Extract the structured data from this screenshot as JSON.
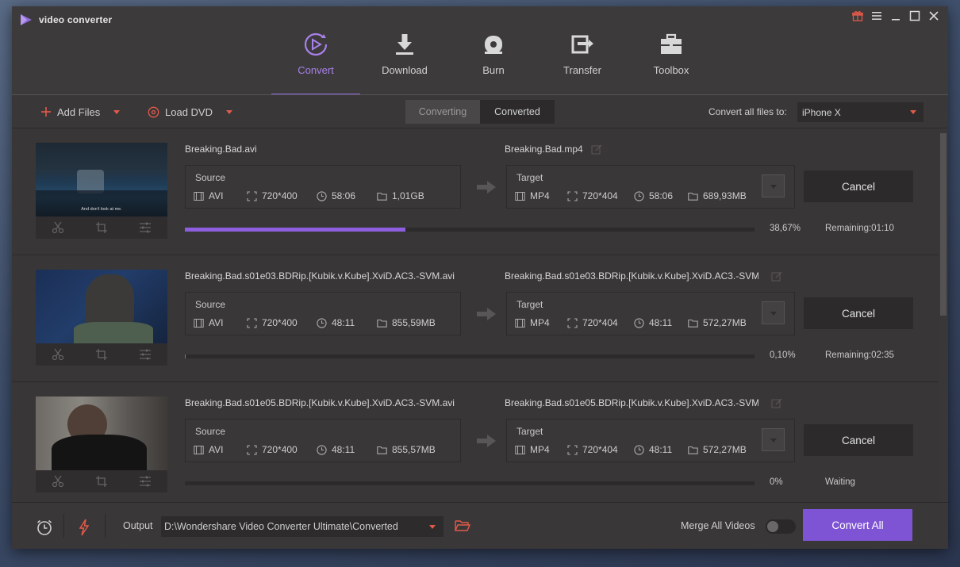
{
  "app": {
    "name": "video converter"
  },
  "nav": [
    {
      "label": "Convert",
      "active": true
    },
    {
      "label": "Download",
      "active": false
    },
    {
      "label": "Burn",
      "active": false
    },
    {
      "label": "Transfer",
      "active": false
    },
    {
      "label": "Toolbox",
      "active": false
    }
  ],
  "toolbar": {
    "add_files": "Add Files",
    "load_dvd": "Load DVD",
    "tab_converting": "Converting",
    "tab_converted": "Converted",
    "convert_all_to_label": "Convert all files to:",
    "format": "iPhone X"
  },
  "rows": [
    {
      "source_name": "Breaking.Bad.avi",
      "target_name": "Breaking.Bad.mp4",
      "source": {
        "title": "Source",
        "format": "AVI",
        "resolution": "720*400",
        "duration": "58:06",
        "size": "1,01GB"
      },
      "target": {
        "title": "Target",
        "format": "MP4",
        "resolution": "720*404",
        "duration": "58:06",
        "size": "689,93MB"
      },
      "cancel_label": "Cancel",
      "progress": 0.3867,
      "percent": "38,67%",
      "status": "Remaining:01:10",
      "subtitle": "And don't look at me."
    },
    {
      "source_name": "Breaking.Bad.s01e03.BDRip.[Kubik.v.Kube].XviD.AC3.-SVM.avi",
      "target_name": "Breaking.Bad.s01e03.BDRip.[Kubik.v.Kube].XviD.AC3.-SVM....",
      "source": {
        "title": "Source",
        "format": "AVI",
        "resolution": "720*400",
        "duration": "48:11",
        "size": "855,59MB"
      },
      "target": {
        "title": "Target",
        "format": "MP4",
        "resolution": "720*404",
        "duration": "48:11",
        "size": "572,27MB"
      },
      "cancel_label": "Cancel",
      "progress": 0.001,
      "percent": "0,10%",
      "status": "Remaining:02:35"
    },
    {
      "source_name": "Breaking.Bad.s01e05.BDRip.[Kubik.v.Kube].XviD.AC3.-SVM.avi",
      "target_name": "Breaking.Bad.s01e05.BDRip.[Kubik.v.Kube].XviD.AC3.-SVM....",
      "source": {
        "title": "Source",
        "format": "AVI",
        "resolution": "720*400",
        "duration": "48:11",
        "size": "855,57MB"
      },
      "target": {
        "title": "Target",
        "format": "MP4",
        "resolution": "720*404",
        "duration": "48:11",
        "size": "572,27MB"
      },
      "cancel_label": "Cancel",
      "progress": 0,
      "percent": "0%",
      "status": "Waiting"
    }
  ],
  "footer": {
    "output_label": "Output",
    "output_path": "D:\\Wondershare Video Converter Ultimate\\Converted",
    "merge_label": "Merge All Videos",
    "merge_on": false,
    "convert_all_label": "Convert All"
  },
  "colors": {
    "accent": "#8d5fe0",
    "accent_button": "#7e54d4",
    "caret": "#e15a4a",
    "window_bg": "#3d3a3b"
  }
}
